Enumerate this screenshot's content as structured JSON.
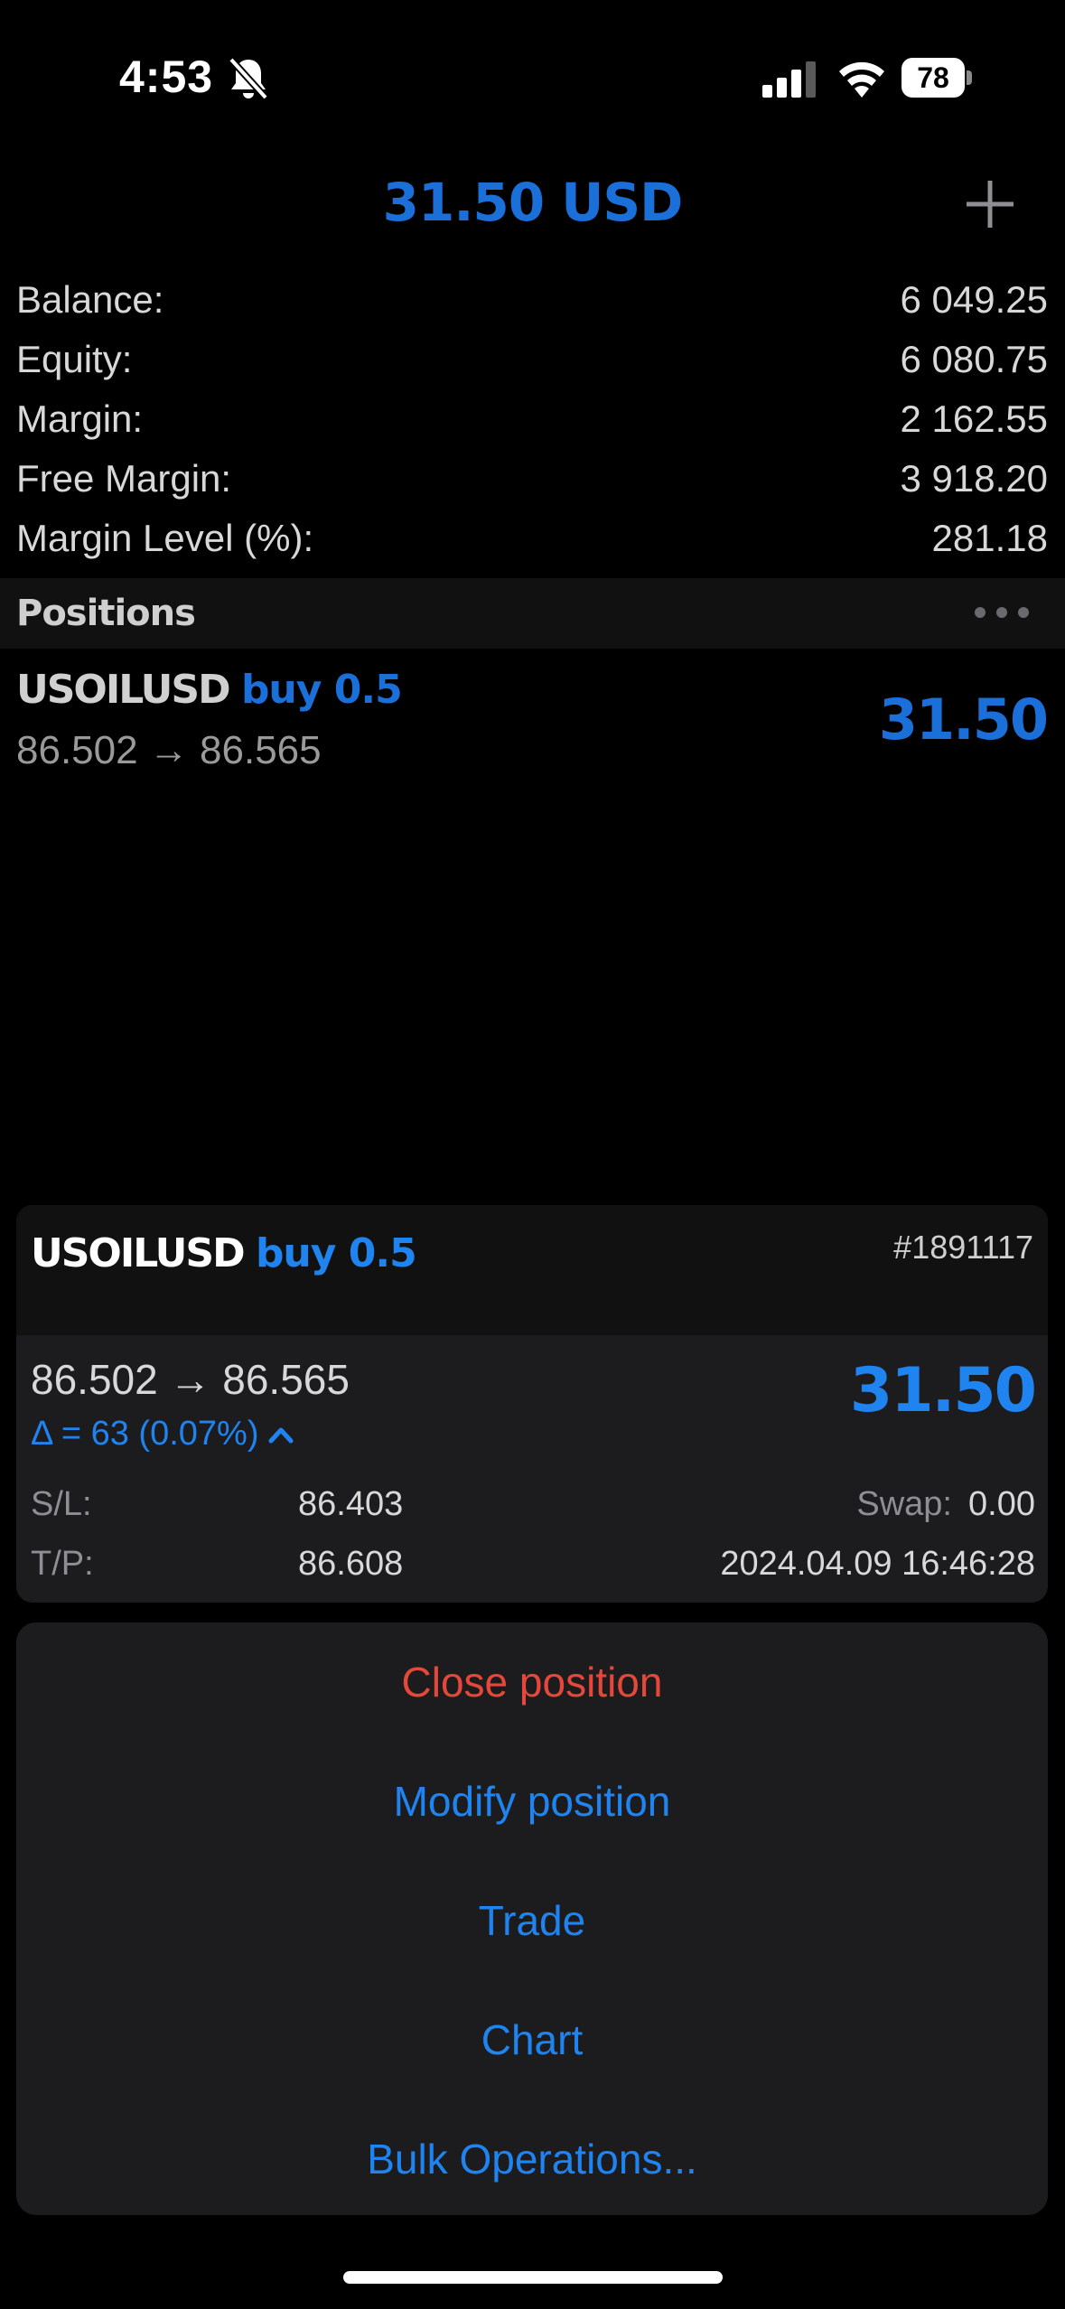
{
  "status_bar": {
    "time": "4:53",
    "battery_level": "78",
    "icons": [
      "bell-slash-icon",
      "cellular-signal-icon",
      "wifi-icon",
      "battery-icon"
    ]
  },
  "header": {
    "total_profit": "31.50 USD",
    "add_icon": "plus-icon"
  },
  "account": {
    "rows": [
      {
        "label": "Balance:",
        "value": "6 049.25"
      },
      {
        "label": "Equity:",
        "value": "6 080.75"
      },
      {
        "label": "Margin:",
        "value": "2 162.55"
      },
      {
        "label": "Free Margin:",
        "value": "3 918.20"
      },
      {
        "label": "Margin Level (%):",
        "value": "281.18"
      }
    ]
  },
  "positions": {
    "title": "Positions",
    "menu_icon": "more-horizontal-icon",
    "items": [
      {
        "symbol": "USOILUSD",
        "side": "buy 0.5",
        "prices": "86.502 → 86.565",
        "profit": "31.50"
      }
    ]
  },
  "detail": {
    "symbol": "USOILUSD",
    "side": "buy 0.5",
    "ticket": "#1891117",
    "prices": "86.502 → 86.565",
    "profit": "31.50",
    "delta": "Δ = 63 (0.07%)",
    "sl_label": "S/L:",
    "sl_value": "86.403",
    "tp_label": "T/P:",
    "tp_value": "86.608",
    "swap_label": "Swap:",
    "swap_value": "0.00",
    "open_time": "2024.04.09 16:46:28"
  },
  "actions": [
    {
      "label": "Close position",
      "style": "danger"
    },
    {
      "label": "Modify position",
      "style": "normal"
    },
    {
      "label": "Trade",
      "style": "normal"
    },
    {
      "label": "Chart",
      "style": "normal"
    },
    {
      "label": "Bulk Operations...",
      "style": "normal"
    }
  ],
  "colors": {
    "accent_blue": "#1f84f0",
    "header_blue": "#1a6fd9",
    "danger_red": "#e5483a",
    "background": "#000000",
    "card_background": "#1c1c1e"
  }
}
